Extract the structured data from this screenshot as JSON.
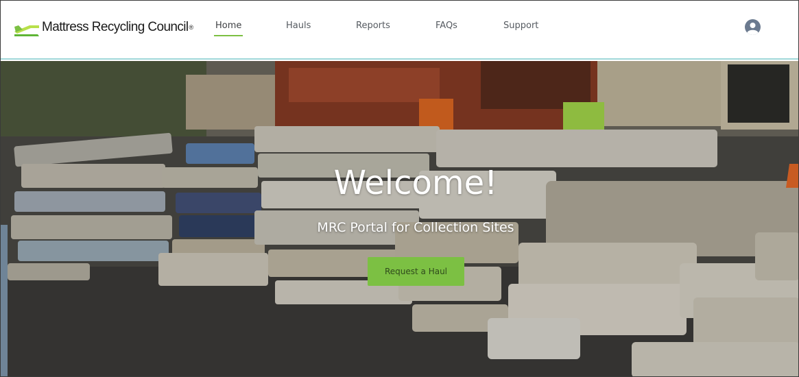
{
  "brand": {
    "name": "Mattress Recycling Council",
    "registered_mark": "®",
    "colors": {
      "accent_green": "#7cc043",
      "logo_green_dark": "#5fb536",
      "logo_green_light": "#b8e04a",
      "header_border": "#9fd7d9",
      "avatar": "#6b7a8f"
    }
  },
  "nav": {
    "items": [
      {
        "label": "Home",
        "active": true
      },
      {
        "label": "Hauls",
        "active": false
      },
      {
        "label": "Reports",
        "active": false
      },
      {
        "label": "FAQs",
        "active": false
      },
      {
        "label": "Support",
        "active": false
      }
    ]
  },
  "user": {
    "icon": "user-avatar-icon"
  },
  "hero": {
    "title": "Welcome!",
    "subtitle": "MRC Portal for Collection Sites",
    "cta_label": "Request a Haul",
    "background_icon": "mattress-pile-photo"
  }
}
